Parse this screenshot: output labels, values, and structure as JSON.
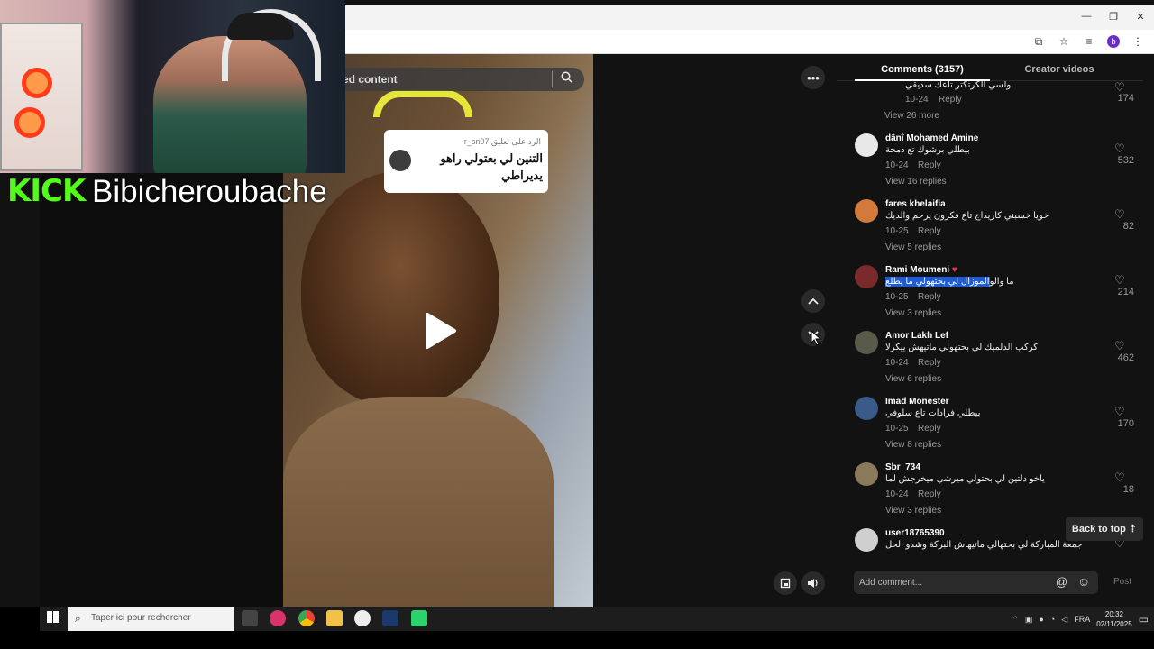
{
  "browser": {
    "profile_initial": "b",
    "window_controls": [
      "—",
      "❐",
      "✕"
    ]
  },
  "overlay": {
    "kick_logo": "KICK",
    "streamer_name": "Bibicheroubache"
  },
  "video": {
    "search_text": "ed content",
    "reply_label": "الرد على تعليق r_sn07",
    "reply_text": "التنين لي بعتولي راهو يديراطي"
  },
  "comments_panel": {
    "tab_comments": "Comments (3157)",
    "tab_creator": "Creator videos",
    "comments": [
      {
        "user": "",
        "text": "ولسي الكرتكتر تاعك سديقي",
        "date": "10-24",
        "reply": "Reply",
        "views": "View 26 more",
        "likes": "174",
        "avatar_color": "#121212"
      },
      {
        "user": "dânî Mohamed Ámine",
        "text": "بيطلي برشوك تع دمجة",
        "date": "10-24",
        "reply": "Reply",
        "views": "View 16 replies",
        "likes": "532",
        "avatar_color": "#e8e8e8"
      },
      {
        "user": "fares khelaifia",
        "text": "خويا خسبني كاريداج تاع فكرون يرحم والديك",
        "date": "10-25",
        "reply": "Reply",
        "views": "View 5 replies",
        "likes": "82",
        "avatar_color": "#d27a3c"
      },
      {
        "user": "Rami Moumeni",
        "text_pre": "الموزال لي بحتهولي ما يطلع",
        "text_post": " ما والو",
        "date": "10-25",
        "reply": "Reply",
        "views": "View 3 replies",
        "likes": "214",
        "avatar_color": "#7a2a2a"
      },
      {
        "user": "Amor Lakh Lef",
        "text": "كركب الدلميك لي بحتهولي ماتيهش ييكرلا",
        "date": "10-24",
        "reply": "Reply",
        "views": "View 6 replies",
        "likes": "462",
        "avatar_color": "#5a5a4a"
      },
      {
        "user": "Imad Monester",
        "text": "بيطلي فرادات تاع سلوفي",
        "date": "10-25",
        "reply": "Reply",
        "views": "View 8 replies",
        "likes": "170",
        "avatar_color": "#3a5a8a"
      },
      {
        "user": "Sbr_734",
        "text": "ياخو دلتين لي بحتولي ميرشي ميخرجش لما",
        "date": "10-24",
        "reply": "Reply",
        "views": "View 3 replies",
        "likes": "18",
        "avatar_color": "#8a7a5a"
      },
      {
        "user": "user18765390",
        "text": "جمعة المباركة لي بحتهالي ماتيهاش البركة وشدو الحل",
        "date": "",
        "reply": "",
        "views": "",
        "likes": "",
        "avatar_color": "#cfcfcf"
      }
    ],
    "back_to_top": "Back to top ⇡",
    "add_comment_placeholder": "Add comment...",
    "post": "Post"
  },
  "taskbar": {
    "search_placeholder": "Taper ici pour rechercher",
    "language": "FRA",
    "time": "20:32",
    "date": "02/11/2025"
  }
}
